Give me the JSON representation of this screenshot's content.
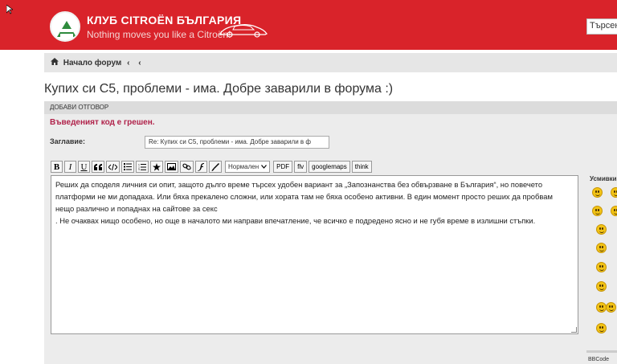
{
  "header": {
    "brand_title": "КЛУБ CITROËN БЪЛГАРИЯ",
    "brand_tagline": "Nothing moves you like a Citroën!",
    "search_placeholder": "Търсене",
    "colors": {
      "header_bg": "#d9232a",
      "logo_green": "#2e8b3d"
    }
  },
  "breadcrumb": {
    "home_icon": "home-icon",
    "home_label": "Начало форум",
    "separators": [
      "‹",
      "‹"
    ]
  },
  "page": {
    "title": "Купих си С5, проблеми - има. Добре заварили в форума :)"
  },
  "reply": {
    "header": "ДОБАВИ ОТГОВОР",
    "error_message": "Въведеният код е грешен.",
    "subject_label": "Заглавие:",
    "subject_value": "Re: Купих си С5, проблеми - има. Добре заварили в ф",
    "toolbar": {
      "bold": "B",
      "italic": "I",
      "underline": "U",
      "font_size_value": "Нормален",
      "pdf": "PDF",
      "flv": "flv",
      "googlemaps": "googlemaps",
      "think": "think"
    },
    "message_lines": [
      "Реших да споделя личния си опит, защото дълго време търсех удобен вариант за „Запознанства без обвързване в България“, но повечето",
      "платформи не ми допадаха. Или бяха прекалено сложни, или хората там не бяха особено активни. В един момент просто реших да пробвам",
      "нещо различно и попаднах на сайтове за секс",
      ". Не очаквах нищо особено, но още в началото ми направи впечатление, че всичко е подредено ясно и не губя време в излишни стъпки."
    ],
    "smilies_label": "Усмивки",
    "bbcode_label": "BBCode"
  }
}
